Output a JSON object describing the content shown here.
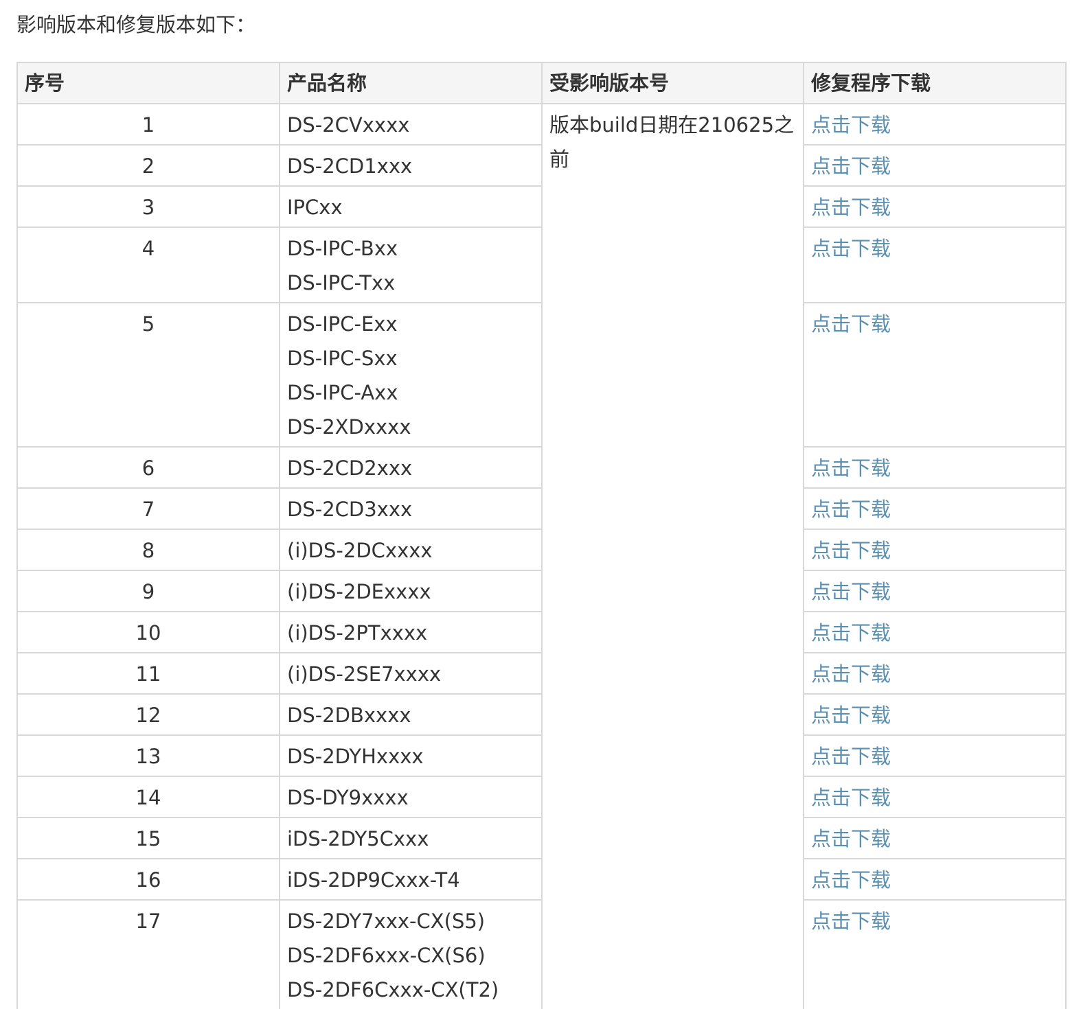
{
  "intro": "影响版本和修复版本如下：",
  "table": {
    "headers": [
      "序号",
      "产品名称",
      "受影响版本号",
      "修复程序下载"
    ],
    "affected_version": "版本build日期在210625之前",
    "download_label": "点击下载",
    "rows": [
      {
        "index": "1",
        "names": [
          "DS-2CVxxxx"
        ]
      },
      {
        "index": "2",
        "names": [
          "DS-2CD1xxx"
        ]
      },
      {
        "index": "3",
        "names": [
          "IPCxx"
        ]
      },
      {
        "index": "4",
        "names": [
          "DS-IPC-Bxx",
          "DS-IPC-Txx"
        ]
      },
      {
        "index": "5",
        "names": [
          "DS-IPC-Exx",
          "DS-IPC-Sxx",
          "DS-IPC-Axx",
          "DS-2XDxxxx"
        ]
      },
      {
        "index": "6",
        "names": [
          "DS-2CD2xxx"
        ]
      },
      {
        "index": "7",
        "names": [
          "DS-2CD3xxx"
        ]
      },
      {
        "index": "8",
        "names": [
          "(i)DS-2DCxxxx"
        ]
      },
      {
        "index": "9",
        "names": [
          "(i)DS-2DExxxx"
        ]
      },
      {
        "index": "10",
        "names": [
          "(i)DS-2PTxxxx"
        ]
      },
      {
        "index": "11",
        "names": [
          "(i)DS-2SE7xxxx"
        ]
      },
      {
        "index": "12",
        "names": [
          "DS-2DBxxxx"
        ]
      },
      {
        "index": "13",
        "names": [
          "DS-2DYHxxxx"
        ]
      },
      {
        "index": "14",
        "names": [
          "DS-DY9xxxx"
        ]
      },
      {
        "index": "15",
        "names": [
          "iDS-2DY5Cxxx"
        ]
      },
      {
        "index": "16",
        "names": [
          "iDS-2DP9Cxxx-T4"
        ]
      },
      {
        "index": "17",
        "names": [
          "DS-2DY7xxx-CX(S5)",
          "DS-2DF6xxx-CX(S6)",
          "DS-2DF6Cxxx-CX(T2)"
        ]
      }
    ]
  },
  "colors": {
    "link": "#5b8fb0",
    "border": "#d8d8d8",
    "header_bg": "#f5f5f5",
    "text": "#333333"
  }
}
